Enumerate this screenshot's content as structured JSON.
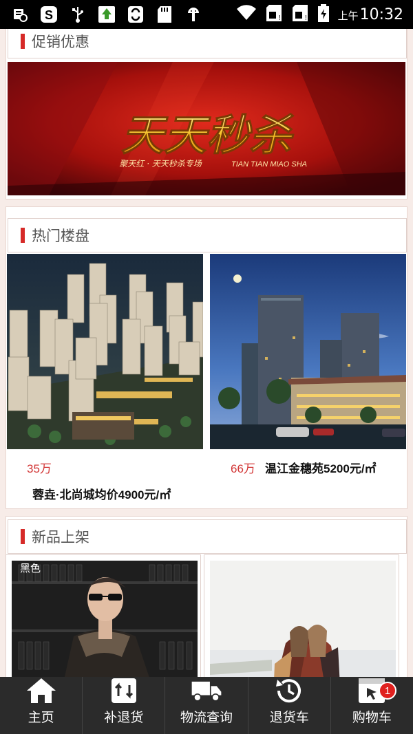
{
  "status_bar": {
    "ampm": "上午",
    "time": "10:32",
    "icons": [
      "notification-icon",
      "sogou-icon",
      "usb-icon",
      "upload-icon",
      "sync-icon",
      "sd-card-icon",
      "android-debug-icon",
      "wifi-icon",
      "sim1-icon",
      "sim2-icon",
      "battery-icon"
    ]
  },
  "sections": {
    "promo": {
      "title": "促销优惠",
      "banner": {
        "headline": "天天秒杀",
        "sub_cn": "聚天红 · 天天秒杀专场",
        "sub_en": "TIAN TIAN MIAO SHA"
      }
    },
    "hot": {
      "title": "热门楼盘",
      "items": [
        {
          "price": "35万",
          "name": "蓉垚·北尚城均价4900元/㎡"
        },
        {
          "price": "66万",
          "name": "温江金穗苑5200元/㎡"
        }
      ]
    },
    "new": {
      "title": "新品上架",
      "items": [
        {
          "tag": "黑色"
        },
        {
          "tag": ""
        }
      ]
    }
  },
  "bottom_nav": {
    "items": [
      {
        "label": "主页",
        "icon": "home-icon"
      },
      {
        "label": "补退货",
        "icon": "exchange-icon"
      },
      {
        "label": "物流查询",
        "icon": "truck-icon"
      },
      {
        "label": "退货车",
        "icon": "history-icon"
      },
      {
        "label": "购物车",
        "icon": "cart-icon",
        "badge": "1"
      }
    ]
  },
  "colors": {
    "accent": "#d62a28",
    "nav_bg": "#2b2b2b",
    "price": "#d23535",
    "page_bg": "#f7ece8"
  }
}
